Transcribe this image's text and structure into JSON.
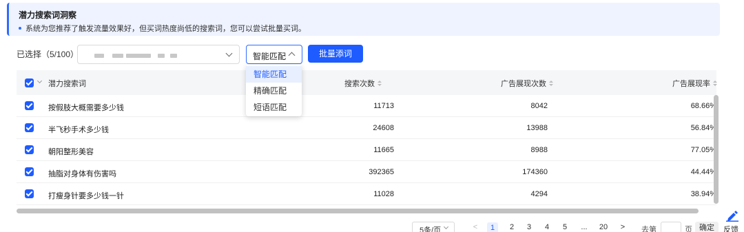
{
  "banner": {
    "title": "潜力搜索词洞察",
    "description": "系统为您推荐了触发流量效果好，但买词热度尚低的搜索词，您可以尝试批量买词。"
  },
  "toolbar": {
    "selected_count": "已选择（5/100）",
    "match_type_value": "智能匹配",
    "batch_add_label": "批量添词"
  },
  "match_dropdown": {
    "options": [
      "智能匹配",
      "精确匹配",
      "短语匹配"
    ],
    "active": "智能匹配"
  },
  "table": {
    "headers": {
      "keyword": "潜力搜索词",
      "search_count": "搜索次数",
      "impressions": "广告展现次数",
      "impression_rate": "广告展现率"
    },
    "rows": [
      {
        "keyword": "按假肢大概需要多少钱",
        "search_count": "11713",
        "impressions": "8042",
        "rate": "68.66%",
        "checked": true
      },
      {
        "keyword": "半飞秒手术多少钱",
        "search_count": "24608",
        "impressions": "13988",
        "rate": "56.84%",
        "checked": true
      },
      {
        "keyword": "朝阳整形美容",
        "search_count": "11665",
        "impressions": "8988",
        "rate": "77.05%",
        "checked": true
      },
      {
        "keyword": "抽脂对身体有伤害吗",
        "search_count": "392365",
        "impressions": "174360",
        "rate": "44.44%",
        "checked": true
      },
      {
        "keyword": "打瘦身针要多少钱一针",
        "search_count": "11028",
        "impressions": "4294",
        "rate": "38.94%",
        "checked": true
      }
    ]
  },
  "pagination": {
    "page_size": "5条/页",
    "prev": "<",
    "pages": [
      "1",
      "2",
      "3",
      "4",
      "5",
      "...",
      "20"
    ],
    "current": "1",
    "next": ">",
    "goto_label": "去第",
    "page_unit": "页",
    "confirm_label": "确定"
  },
  "feedback": {
    "label": "反馈",
    "icon": "pen-icon"
  },
  "colors": {
    "primary": "#1e5cff",
    "banner_bg": "#eef3ff",
    "header_bg": "#f5f6f8"
  }
}
